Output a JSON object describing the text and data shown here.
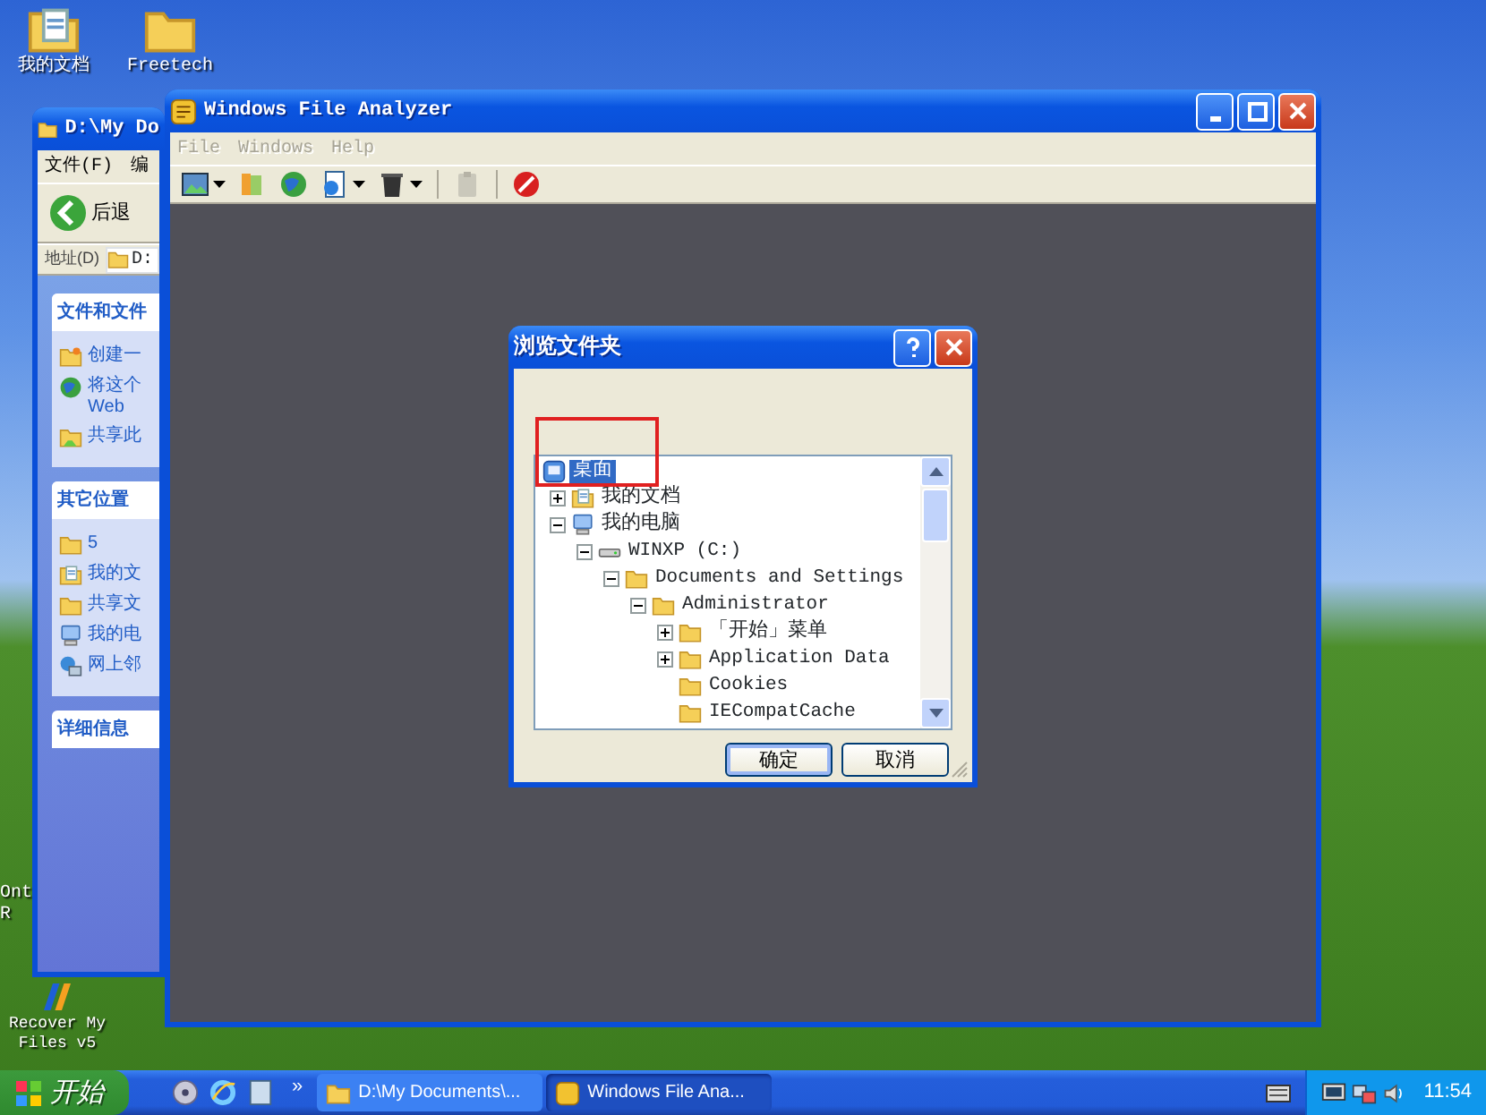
{
  "desktop": {
    "icons": [
      {
        "label": "我的文档",
        "kind": "documents"
      },
      {
        "label": "Freetech",
        "kind": "folder"
      },
      {
        "label": "Recover My Files v5",
        "kind": "app"
      }
    ],
    "cut_labels": [
      "Ont",
      "R"
    ]
  },
  "explorer_window": {
    "title": "D:\\My Do",
    "menu": [
      "文件(F)",
      "编"
    ],
    "back_button": "后退",
    "address_label": "地址(D)",
    "address_value": "D:",
    "panes": [
      {
        "title": "文件和文件",
        "expanded": true,
        "items": [
          {
            "label": "创建一",
            "kind": "new-folder"
          },
          {
            "label": "将这个",
            "label_2": "Web",
            "kind": "globe"
          },
          {
            "label": "共享此",
            "kind": "share"
          }
        ]
      },
      {
        "title": "其它位置",
        "expanded": true,
        "items": [
          {
            "label": "5",
            "kind": "folder"
          },
          {
            "label": "我的文",
            "kind": "documents"
          },
          {
            "label": "共享文",
            "kind": "folder"
          },
          {
            "label": "我的电",
            "kind": "computer"
          },
          {
            "label": "网上邻",
            "kind": "network"
          }
        ]
      },
      {
        "title": "详细信息",
        "expanded": false
      }
    ]
  },
  "main_window": {
    "title": "Windows File Analyzer",
    "menu": [
      {
        "label": "File",
        "disabled": true
      },
      {
        "label": "Windows",
        "disabled": true
      },
      {
        "label": "Help",
        "disabled": true
      }
    ],
    "toolbar": [
      {
        "kind": "picture",
        "dropdown": true,
        "disabled": false
      },
      {
        "kind": "books",
        "dropdown": false,
        "disabled": false
      },
      {
        "kind": "globe",
        "dropdown": false,
        "disabled": false
      },
      {
        "kind": "document",
        "dropdown": true,
        "disabled": false
      },
      {
        "kind": "bin",
        "dropdown": true,
        "disabled": false
      },
      {
        "kind": "clipboard",
        "dropdown": false,
        "disabled": true
      },
      {
        "kind": "stop",
        "dropdown": false,
        "disabled": false
      }
    ]
  },
  "dialog": {
    "title": "浏览文件夹",
    "tree": [
      {
        "label": "桌面",
        "kind": "desktop",
        "selected": true,
        "children": [
          {
            "label": "我的文档",
            "kind": "documents",
            "selected": false,
            "expanded": false
          },
          {
            "label": "我的电脑",
            "kind": "computer",
            "selected": false,
            "expanded": true,
            "children": [
              {
                "label": "WINXP (C:)",
                "kind": "drive",
                "selected": false,
                "expanded": true,
                "children": [
                  {
                    "label": "Documents and Settings",
                    "kind": "folder",
                    "selected": false,
                    "expanded": true,
                    "children": [
                      {
                        "label": "Administrator",
                        "kind": "folder",
                        "selected": false,
                        "expanded": true,
                        "children": [
                          {
                            "label": "「开始」菜单",
                            "kind": "folder",
                            "selected": false,
                            "expanded": false
                          },
                          {
                            "label": "Application Data",
                            "kind": "folder",
                            "selected": false,
                            "expanded": false
                          },
                          {
                            "label": "Cookies",
                            "kind": "folder",
                            "selected": false
                          },
                          {
                            "label": "IECompatCache",
                            "kind": "folder",
                            "selected": false
                          }
                        ]
                      }
                    ]
                  }
                ]
              }
            ]
          }
        ]
      }
    ],
    "buttons": [
      {
        "label": "确定",
        "default": true
      },
      {
        "label": "取消",
        "default": false
      }
    ]
  },
  "taskbar": {
    "start": "开始",
    "quick_launch": [
      {
        "kind": "media"
      },
      {
        "kind": "browser"
      },
      {
        "kind": "desktop"
      }
    ],
    "chevron": "»",
    "tasks": [
      {
        "label": "D:\\My Documents\\...",
        "kind": "folder",
        "selected": false
      },
      {
        "label": "Windows File Ana...",
        "kind": "app",
        "selected": true
      }
    ],
    "tray": [
      {
        "kind": "monitor"
      },
      {
        "kind": "network"
      },
      {
        "kind": "speaker"
      }
    ],
    "clock": "11:54"
  }
}
